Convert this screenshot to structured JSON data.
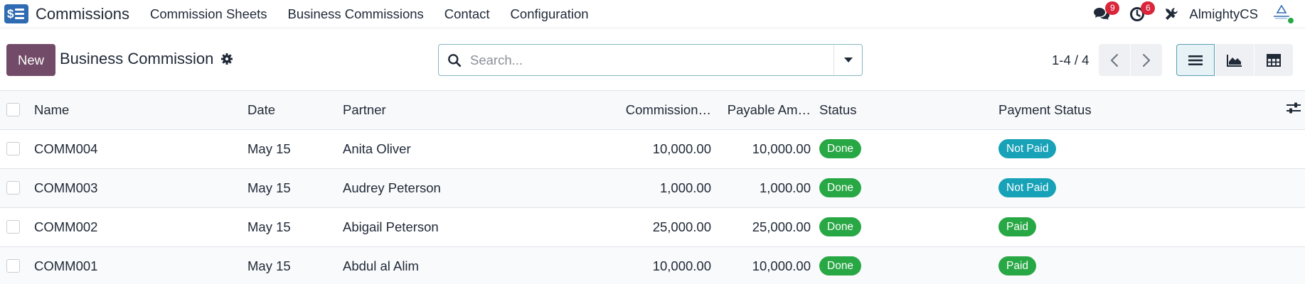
{
  "app": {
    "name": "Commissions",
    "menu": [
      {
        "label": "Commission Sheets"
      },
      {
        "label": "Business Commissions"
      },
      {
        "label": "Contact"
      },
      {
        "label": "Configuration"
      }
    ],
    "messages_count": "9",
    "activities_count": "6",
    "user_name": "AlmightyCS"
  },
  "control": {
    "new_label": "New",
    "title": "Business Commission",
    "search_placeholder": "Search...",
    "pager": "1-4 / 4"
  },
  "table": {
    "columns": {
      "name": "Name",
      "date": "Date",
      "partner": "Partner",
      "commission": "Commission…",
      "payable": "Payable Am…",
      "status": "Status",
      "payment_status": "Payment Status"
    },
    "rows": [
      {
        "name": "COMM004",
        "date": "May 15",
        "partner": "Anita Oliver",
        "commission": "10,000.00",
        "payable": "10,000.00",
        "status": "Done",
        "payment_status": "Not Paid"
      },
      {
        "name": "COMM003",
        "date": "May 15",
        "partner": "Audrey Peterson",
        "commission": "1,000.00",
        "payable": "1,000.00",
        "status": "Done",
        "payment_status": "Not Paid"
      },
      {
        "name": "COMM002",
        "date": "May 15",
        "partner": "Abigail Peterson",
        "commission": "25,000.00",
        "payable": "25,000.00",
        "status": "Done",
        "payment_status": "Paid"
      },
      {
        "name": "COMM001",
        "date": "May 15",
        "partner": "Abdul al Alim",
        "commission": "10,000.00",
        "payable": "10,000.00",
        "status": "Done",
        "payment_status": "Paid"
      }
    ]
  },
  "colors": {
    "brand": "#714b67",
    "done": "#28a745",
    "not_paid": "#17a2b8",
    "paid": "#28a745",
    "badge": "#d9263b"
  },
  "icons": [
    "app-logo-icon",
    "chat-icon",
    "clock-icon",
    "tools-icon",
    "gear-icon",
    "search-icon",
    "caret-down-icon",
    "chevron-left-icon",
    "chevron-right-icon",
    "list-view-icon",
    "graph-view-icon",
    "pivot-view-icon",
    "column-settings-icon"
  ]
}
